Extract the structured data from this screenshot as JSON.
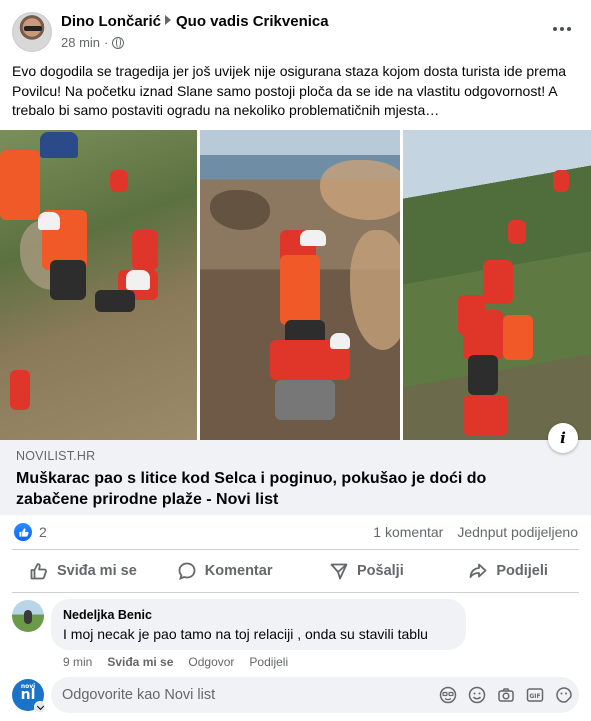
{
  "post": {
    "author": "Dino Lončarić",
    "group": "Quo vadis Crikvenica",
    "time": "28 min",
    "text": "Evo dogodila se tragedija jer još uvijek nije osigurana staza kojom dosta turista ide prema Povilcu! Na početku iznad Slane samo postoji ploča da se ide na vlastitu odgovornost! A trebalo bi samo postaviti ogradu na nekoliko problematičnih mjesta…",
    "more_icon": "three-dots-icon",
    "audience_icon": "globe-icon"
  },
  "link": {
    "domain": "NOVILIST.HR",
    "title": "Muškarac pao s litice kod Selca i poginuo, pokušao je doći do zabačene prirodne plaže - Novi list",
    "info_label": "i"
  },
  "reactions": {
    "count": "2",
    "comments": "1 komentar",
    "shares": "Jednput podijeljeno"
  },
  "actions": {
    "like": "Sviđa mi se",
    "comment": "Komentar",
    "send": "Pošalji",
    "share": "Podijeli"
  },
  "comment": {
    "author": "Nedeljka Benic",
    "text": "I moj necak je pao tamo na toj relaciji , onda su stavili tablu",
    "time": "9 min",
    "like": "Sviđa mi se",
    "reply": "Odgovor",
    "share": "Podijeli"
  },
  "reply_box": {
    "avatar_text": "nl",
    "avatar_top": "novi",
    "placeholder": "Odgovorite kao Novi list"
  }
}
